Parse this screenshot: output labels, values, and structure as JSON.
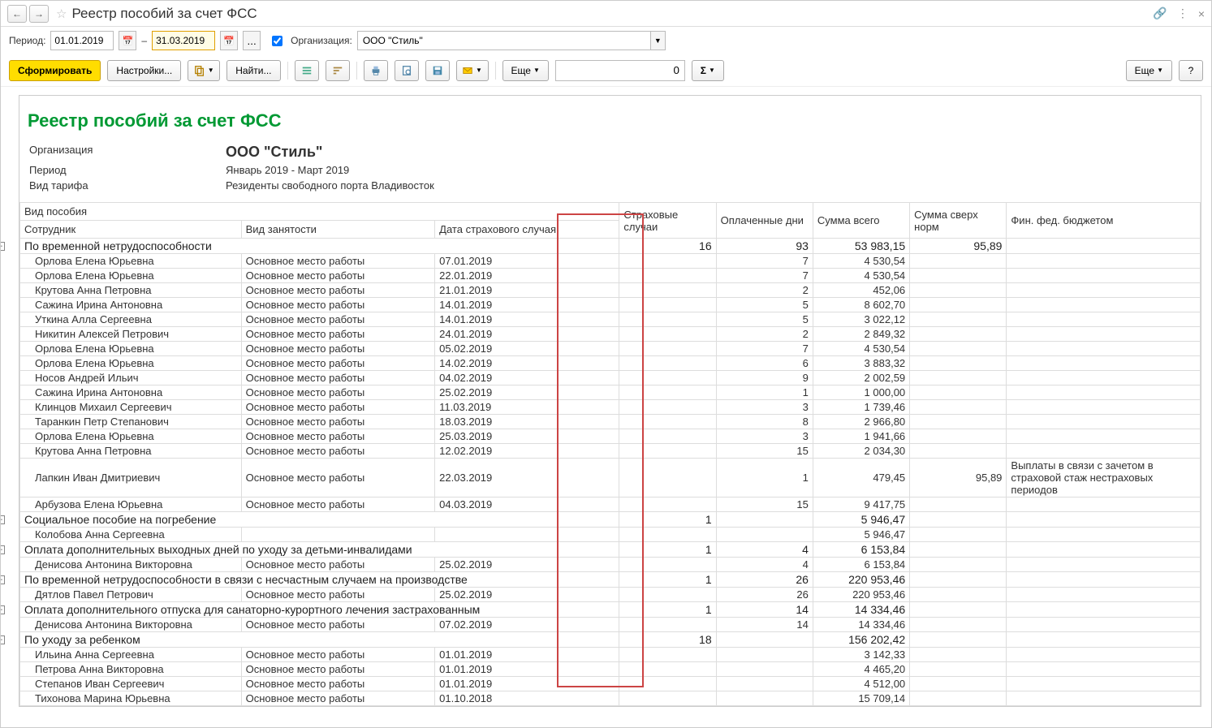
{
  "window": {
    "title": "Реестр пособий за счет ФСС",
    "nav_back": "←",
    "nav_fwd": "→",
    "star": "☆",
    "link": "🔗",
    "more": "⋮",
    "close": "×"
  },
  "filter": {
    "period_label": "Период:",
    "date_from": "01.01.2019",
    "dash": "–",
    "date_to": "31.03.2019",
    "dots": "...",
    "org_label": "Организация:",
    "org_value": "ООО \"Стиль\""
  },
  "toolbar": {
    "generate": "Сформировать",
    "settings": "Настройки...",
    "find": "Найти...",
    "more": "Еще",
    "spin_value": "0",
    "help": "?"
  },
  "report": {
    "title": "Реестр пособий за счет ФСС",
    "meta": {
      "org_label": "Организация",
      "org_value": "ООО \"Стиль\"",
      "period_label": "Период",
      "period_value": "Январь 2019 - Март 2019",
      "tariff_label": "Вид тарифа",
      "tariff_value": "Резиденты свободного порта Владивосток"
    },
    "headers": {
      "benefit_type": "Вид пособия",
      "employee": "Сотрудник",
      "emp_type": "Вид занятости",
      "case_date": "Дата страхового случая",
      "cases": "Страховые случаи",
      "days": "Оплаченные дни",
      "sum": "Сумма всего",
      "over_norm": "Сумма сверх норм",
      "fed_budget": "Фин. фед. бюджетом"
    },
    "groups": [
      {
        "title": "По временной нетрудоспособности",
        "cases": "16",
        "days": "93",
        "sum": "53 983,15",
        "over": "95,89",
        "rows": [
          {
            "emp": "Орлова Елена Юрьевна",
            "type": "Основное место работы",
            "date": "07.01.2019",
            "days": "7",
            "sum": "4 530,54"
          },
          {
            "emp": "Орлова Елена Юрьевна",
            "type": "Основное место работы",
            "date": "22.01.2019",
            "days": "7",
            "sum": "4 530,54"
          },
          {
            "emp": "Крутова Анна Петровна",
            "type": "Основное место работы",
            "date": "21.01.2019",
            "days": "2",
            "sum": "452,06"
          },
          {
            "emp": "Сажина Ирина Антоновна",
            "type": "Основное место работы",
            "date": "14.01.2019",
            "days": "5",
            "sum": "8 602,70"
          },
          {
            "emp": "Уткина Алла Сергеевна",
            "type": "Основное место работы",
            "date": "14.01.2019",
            "days": "5",
            "sum": "3 022,12"
          },
          {
            "emp": "Никитин Алексей Петрович",
            "type": "Основное место работы",
            "date": "24.01.2019",
            "days": "2",
            "sum": "2 849,32"
          },
          {
            "emp": "Орлова Елена Юрьевна",
            "type": "Основное место работы",
            "date": "05.02.2019",
            "days": "7",
            "sum": "4 530,54"
          },
          {
            "emp": "Орлова Елена Юрьевна",
            "type": "Основное место работы",
            "date": "14.02.2019",
            "days": "6",
            "sum": "3 883,32"
          },
          {
            "emp": "Носов Андрей Ильич",
            "type": "Основное место работы",
            "date": "04.02.2019",
            "days": "9",
            "sum": "2 002,59"
          },
          {
            "emp": "Сажина Ирина Антоновна",
            "type": "Основное место работы",
            "date": "25.02.2019",
            "days": "1",
            "sum": "1 000,00"
          },
          {
            "emp": "Клинцов Михаил Сергеевич",
            "type": "Основное место работы",
            "date": "11.03.2019",
            "days": "3",
            "sum": "1 739,46"
          },
          {
            "emp": "Таранкин Петр Степанович",
            "type": "Основное место работы",
            "date": "18.03.2019",
            "days": "8",
            "sum": "2 966,80"
          },
          {
            "emp": "Орлова Елена Юрьевна",
            "type": "Основное место работы",
            "date": "25.03.2019",
            "days": "3",
            "sum": "1 941,66"
          },
          {
            "emp": "Крутова Анна Петровна",
            "type": "Основное место работы",
            "date": "12.02.2019",
            "days": "15",
            "sum": "2 034,30"
          },
          {
            "emp": "Лапкин Иван Дмитриевич",
            "type": "Основное место работы",
            "date": "22.03.2019",
            "days": "1",
            "sum": "479,45",
            "over": "95,89",
            "note": "Выплаты в связи с зачетом в страховой стаж нестраховых периодов"
          },
          {
            "emp": "Арбузова Елена Юрьевна",
            "type": "Основное место работы",
            "date": "04.03.2019",
            "days": "15",
            "sum": "9 417,75"
          }
        ]
      },
      {
        "title": "Социальное пособие на погребение",
        "cases": "1",
        "sum": "5 946,47",
        "rows": [
          {
            "emp": "Колобова Анна Сергеевна",
            "sum": "5 946,47"
          }
        ]
      },
      {
        "title": "Оплата дополнительных выходных дней по уходу за детьми-инвалидами",
        "cases": "1",
        "days": "4",
        "sum": "6 153,84",
        "rows": [
          {
            "emp": "Денисова Антонина Викторовна",
            "type": "Основное место работы",
            "date": "25.02.2019",
            "days": "4",
            "sum": "6 153,84"
          }
        ]
      },
      {
        "title": "По временной нетрудоспособности в связи с несчастным случаем на производстве",
        "cases": "1",
        "days": "26",
        "sum": "220 953,46",
        "rows": [
          {
            "emp": "Дятлов Павел Петрович",
            "type": "Основное место работы",
            "date": "25.02.2019",
            "days": "26",
            "sum": "220 953,46"
          }
        ]
      },
      {
        "title": "Оплата дополнительного отпуска для санаторно-курортного лечения застрахованным",
        "cases": "1",
        "days": "14",
        "sum": "14 334,46",
        "rows": [
          {
            "emp": "Денисова Антонина Викторовна",
            "type": "Основное место работы",
            "date": "07.02.2019",
            "days": "14",
            "sum": "14 334,46"
          }
        ]
      },
      {
        "title": "По уходу за ребенком",
        "cases": "18",
        "sum": "156 202,42",
        "rows": [
          {
            "emp": "Ильина Анна Сергеевна",
            "type": "Основное место работы",
            "date": "01.01.2019",
            "sum": "3 142,33"
          },
          {
            "emp": "Петрова Анна Викторовна",
            "type": "Основное место работы",
            "date": "01.01.2019",
            "sum": "4 465,20"
          },
          {
            "emp": "Степанов Иван Сергеевич",
            "type": "Основное место работы",
            "date": "01.01.2019",
            "sum": "4 512,00"
          },
          {
            "emp": "Тихонова Марина Юрьевна",
            "type": "Основное место работы",
            "date": "01.10.2018",
            "sum": "15 709,14"
          }
        ]
      }
    ]
  }
}
